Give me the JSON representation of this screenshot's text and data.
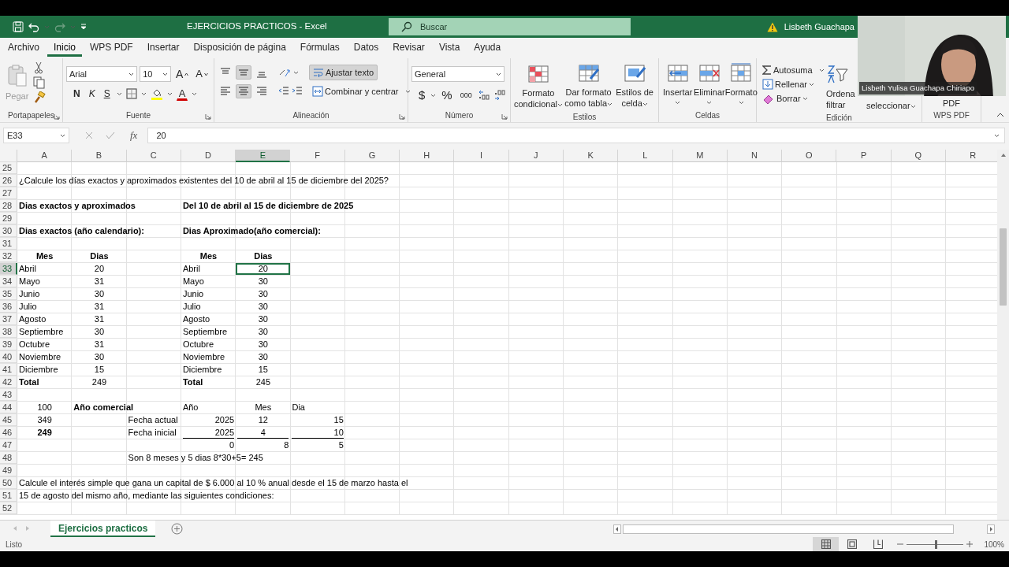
{
  "title_bar": {
    "title": "EJERCICIOS PRACTICOS  -  Excel",
    "search_placeholder": "Buscar",
    "user": "Lisbeth Guachapa"
  },
  "ribbon_tabs": [
    {
      "label": "Archivo",
      "selected": false
    },
    {
      "label": "Inicio",
      "selected": true
    },
    {
      "label": "WPS PDF",
      "selected": false
    },
    {
      "label": "Insertar",
      "selected": false
    },
    {
      "label": "Disposición de página",
      "selected": false
    },
    {
      "label": "Fórmulas",
      "selected": false
    },
    {
      "label": "Datos",
      "selected": false
    },
    {
      "label": "Revisar",
      "selected": false
    },
    {
      "label": "Vista",
      "selected": false
    },
    {
      "label": "Ayuda",
      "selected": false
    }
  ],
  "ribbon": {
    "clipboard": {
      "paste": "Pegar",
      "label": "Portapapeles"
    },
    "font": {
      "name": "Arial",
      "size": "10",
      "grow": "A",
      "shrink": "A",
      "bold": "N",
      "italic": "K",
      "underline": "S",
      "font_color_button": "A",
      "label": "Fuente"
    },
    "alignment": {
      "middle_on": true,
      "center_on": true,
      "wrap": "Ajustar texto",
      "wrap_on": true,
      "merge": "Combinar y centrar",
      "label": "Alineación"
    },
    "number": {
      "format": "General",
      "currency": "$",
      "percent": "%",
      "thousands": "000",
      "label": "Número"
    },
    "styles": {
      "conditional": "Formato\ncondicional",
      "table": "Dar formato\ncomo tabla",
      "cell": "Estilos de\ncelda",
      "label": "Estilos"
    },
    "cells": {
      "insert": "Insertar",
      "delete": "Eliminar",
      "format": "Formato",
      "label": "Celdas"
    },
    "editing": {
      "autosum": "Autosuma",
      "fill": "Rellenar",
      "clear": "Borrar",
      "sort": "Ordena\nfiltrar",
      "find": "seleccionar",
      "label": "Edición"
    },
    "wps": {
      "button": "PDF",
      "label": "WPS PDF"
    }
  },
  "formula_bar": {
    "name_box": "E33",
    "fx": "fx",
    "value": "20"
  },
  "sheet": {
    "columns": [
      {
        "label": "A",
        "selected": false
      },
      {
        "label": "B",
        "selected": false
      },
      {
        "label": "C",
        "selected": false
      },
      {
        "label": "D",
        "selected": false
      },
      {
        "label": "E",
        "selected": true
      },
      {
        "label": "F",
        "selected": false
      },
      {
        "label": "G",
        "selected": false
      },
      {
        "label": "H",
        "selected": false
      },
      {
        "label": "I",
        "selected": false
      },
      {
        "label": "J",
        "selected": false
      },
      {
        "label": "K",
        "selected": false
      },
      {
        "label": "L",
        "selected": false
      },
      {
        "label": "M",
        "selected": false
      },
      {
        "label": "N",
        "selected": false
      },
      {
        "label": "O",
        "selected": false
      },
      {
        "label": "P",
        "selected": false
      },
      {
        "label": "Q",
        "selected": false
      },
      {
        "label": "R",
        "selected": false
      }
    ],
    "rows": [
      {
        "label": "25",
        "selected": false,
        "cells": []
      },
      {
        "label": "26",
        "selected": false,
        "cells": [
          {
            "text": "¿Calcule los días exactos y aproximados existentes del  10 de abril al 15 de diciembre del 2025?",
            "kind": "text",
            "bold": false,
            "underlined": false,
            "selected": false
          }
        ]
      },
      {
        "label": "27",
        "selected": false,
        "cells": []
      },
      {
        "label": "28",
        "selected": false,
        "cells": [
          {
            "text": "Dias exactos y aproximados",
            "kind": "text",
            "bold": true,
            "underlined": false,
            "selected": false
          },
          "",
          "",
          {
            "text": "Del 10 de abril al 15 de diciembre de 2025",
            "kind": "text",
            "bold": true,
            "underlined": false,
            "selected": false
          }
        ]
      },
      {
        "label": "29",
        "selected": false,
        "cells": []
      },
      {
        "label": "30",
        "selected": false,
        "cells": [
          {
            "text": "Dias exactos (año calendario):",
            "kind": "text",
            "bold": true,
            "underlined": false,
            "selected": false
          },
          "",
          "",
          {
            "text": "Dias Aproximado(año comercial):",
            "kind": "text",
            "bold": true,
            "underlined": false,
            "selected": false
          }
        ]
      },
      {
        "label": "31",
        "selected": false,
        "cells": []
      },
      {
        "label": "32",
        "selected": false,
        "cells": [
          {
            "text": "Mes",
            "kind": "centered",
            "bold": true,
            "underlined": false,
            "selected": false
          },
          {
            "text": "Dias",
            "kind": "centered",
            "bold": true,
            "underlined": false,
            "selected": false
          },
          "",
          {
            "text": "Mes",
            "kind": "centered",
            "bold": true,
            "underlined": false,
            "selected": false
          },
          {
            "text": "Dias",
            "kind": "centered",
            "bold": true,
            "underlined": false,
            "selected": false
          }
        ]
      },
      {
        "label": "33",
        "selected": true,
        "cells": [
          {
            "text": "Abril",
            "kind": "text",
            "bold": false,
            "underlined": false,
            "selected": false
          },
          {
            "text": "20",
            "kind": "centered",
            "bold": false,
            "underlined": false,
            "selected": false
          },
          "",
          {
            "text": "Abril",
            "kind": "text",
            "bold": false,
            "underlined": false,
            "selected": false
          },
          {
            "text": "20",
            "kind": "centered",
            "bold": false,
            "underlined": false,
            "selected": true
          }
        ]
      },
      {
        "label": "34",
        "selected": false,
        "cells": [
          {
            "text": "Mayo",
            "kind": "text",
            "bold": false,
            "underlined": false,
            "selected": false
          },
          {
            "text": "31",
            "kind": "centered",
            "bold": false,
            "underlined": false,
            "selected": false
          },
          "",
          {
            "text": "Mayo",
            "kind": "text",
            "bold": false,
            "underlined": false,
            "selected": false
          },
          {
            "text": "30",
            "kind": "centered",
            "bold": false,
            "underlined": false,
            "selected": false
          }
        ]
      },
      {
        "label": "35",
        "selected": false,
        "cells": [
          {
            "text": "Junio",
            "kind": "text",
            "bold": false,
            "underlined": false,
            "selected": false
          },
          {
            "text": "30",
            "kind": "centered",
            "bold": false,
            "underlined": false,
            "selected": false
          },
          "",
          {
            "text": "Junio",
            "kind": "text",
            "bold": false,
            "underlined": false,
            "selected": false
          },
          {
            "text": "30",
            "kind": "centered",
            "bold": false,
            "underlined": false,
            "selected": false
          }
        ]
      },
      {
        "label": "36",
        "selected": false,
        "cells": [
          {
            "text": "Julio",
            "kind": "text",
            "bold": false,
            "underlined": false,
            "selected": false
          },
          {
            "text": "31",
            "kind": "centered",
            "bold": false,
            "underlined": false,
            "selected": false
          },
          "",
          {
            "text": "Julio",
            "kind": "text",
            "bold": false,
            "underlined": false,
            "selected": false
          },
          {
            "text": "30",
            "kind": "centered",
            "bold": false,
            "underlined": false,
            "selected": false
          }
        ]
      },
      {
        "label": "37",
        "selected": false,
        "cells": [
          {
            "text": "Agosto",
            "kind": "text",
            "bold": false,
            "underlined": false,
            "selected": false
          },
          {
            "text": "31",
            "kind": "centered",
            "bold": false,
            "underlined": false,
            "selected": false
          },
          "",
          {
            "text": "Agosto",
            "kind": "text",
            "bold": false,
            "underlined": false,
            "selected": false
          },
          {
            "text": "30",
            "kind": "centered",
            "bold": false,
            "underlined": false,
            "selected": false
          }
        ]
      },
      {
        "label": "38",
        "selected": false,
        "cells": [
          {
            "text": "Septiembre",
            "kind": "text",
            "bold": false,
            "underlined": false,
            "selected": false
          },
          {
            "text": "30",
            "kind": "centered",
            "bold": false,
            "underlined": false,
            "selected": false
          },
          "",
          {
            "text": "Septiembre",
            "kind": "text",
            "bold": false,
            "underlined": false,
            "selected": false
          },
          {
            "text": "30",
            "kind": "centered",
            "bold": false,
            "underlined": false,
            "selected": false
          }
        ]
      },
      {
        "label": "39",
        "selected": false,
        "cells": [
          {
            "text": "Octubre",
            "kind": "text",
            "bold": false,
            "underlined": false,
            "selected": false
          },
          {
            "text": "31",
            "kind": "centered",
            "bold": false,
            "underlined": false,
            "selected": false
          },
          "",
          {
            "text": "Octubre",
            "kind": "text",
            "bold": false,
            "underlined": false,
            "selected": false
          },
          {
            "text": "30",
            "kind": "centered",
            "bold": false,
            "underlined": false,
            "selected": false
          }
        ]
      },
      {
        "label": "40",
        "selected": false,
        "cells": [
          {
            "text": "Noviembre",
            "kind": "text",
            "bold": false,
            "underlined": false,
            "selected": false
          },
          {
            "text": "30",
            "kind": "centered",
            "bold": false,
            "underlined": false,
            "selected": false
          },
          "",
          {
            "text": "Noviembre",
            "kind": "text",
            "bold": false,
            "underlined": false,
            "selected": false
          },
          {
            "text": "30",
            "kind": "centered",
            "bold": false,
            "underlined": false,
            "selected": false
          }
        ]
      },
      {
        "label": "41",
        "selected": false,
        "cells": [
          {
            "text": "Diciembre",
            "kind": "text",
            "bold": false,
            "underlined": false,
            "selected": false
          },
          {
            "text": "15",
            "kind": "centered",
            "bold": false,
            "underlined": false,
            "selected": false
          },
          "",
          {
            "text": "Diciembre",
            "kind": "text",
            "bold": false,
            "underlined": false,
            "selected": false
          },
          {
            "text": "15",
            "kind": "centered",
            "bold": false,
            "underlined": false,
            "selected": false
          }
        ]
      },
      {
        "label": "42",
        "selected": false,
        "cells": [
          {
            "text": "Total",
            "kind": "text",
            "bold": true,
            "underlined": false,
            "selected": false
          },
          {
            "text": "249",
            "kind": "centered",
            "bold": false,
            "underlined": false,
            "selected": false
          },
          "",
          {
            "text": "Total",
            "kind": "text",
            "bold": true,
            "underlined": false,
            "selected": false
          },
          {
            "text": "245",
            "kind": "centered",
            "bold": false,
            "underlined": false,
            "selected": false
          }
        ]
      },
      {
        "label": "43",
        "selected": false,
        "cells": []
      },
      {
        "label": "44",
        "selected": false,
        "cells": [
          {
            "text": "100",
            "kind": "centered",
            "bold": false,
            "underlined": false,
            "selected": false
          },
          {
            "text": "Año comercial",
            "kind": "text",
            "bold": true,
            "underlined": false,
            "selected": false
          },
          "",
          {
            "text": "Año",
            "kind": "text",
            "bold": false,
            "underlined": false,
            "selected": false
          },
          {
            "text": "Mes",
            "kind": "centered",
            "bold": false,
            "underlined": false,
            "selected": false
          },
          {
            "text": "Dia",
            "kind": "text",
            "bold": false,
            "underlined": false,
            "selected": false
          }
        ]
      },
      {
        "label": "45",
        "selected": false,
        "cells": [
          {
            "text": "349",
            "kind": "centered",
            "bold": false,
            "underlined": false,
            "selected": false
          },
          "",
          {
            "text": "Fecha actual",
            "kind": "text",
            "bold": false,
            "underlined": false,
            "selected": false
          },
          {
            "text": "2025",
            "kind": "number",
            "bold": false,
            "underlined": false,
            "selected": false
          },
          {
            "text": "12",
            "kind": "centered",
            "bold": false,
            "underlined": false,
            "selected": false
          },
          {
            "text": "15",
            "kind": "number",
            "bold": false,
            "underlined": false,
            "selected": false
          }
        ]
      },
      {
        "label": "46",
        "selected": false,
        "cells": [
          {
            "text": "249",
            "kind": "centered",
            "bold": true,
            "underlined": false,
            "selected": false
          },
          "",
          {
            "text": "Fecha inicial",
            "kind": "text",
            "bold": false,
            "underlined": false,
            "selected": false
          },
          {
            "text": "2025",
            "kind": "number",
            "bold": false,
            "underlined": true,
            "selected": false
          },
          {
            "text": "4",
            "kind": "centered",
            "bold": false,
            "underlined": true,
            "selected": false
          },
          {
            "text": "10",
            "kind": "number",
            "bold": false,
            "underlined": true,
            "selected": false
          }
        ]
      },
      {
        "label": "47",
        "selected": false,
        "cells": [
          "",
          "",
          "",
          {
            "text": "0",
            "kind": "number",
            "bold": false,
            "underlined": false,
            "selected": false
          },
          {
            "text": "8",
            "kind": "number",
            "bold": false,
            "underlined": false,
            "selected": false
          },
          {
            "text": "5",
            "kind": "number",
            "bold": false,
            "underlined": false,
            "selected": false
          }
        ]
      },
      {
        "label": "48",
        "selected": false,
        "cells": [
          "",
          "",
          {
            "text": "Son 8 meses y 5 dias 8*30+5= 245",
            "kind": "text",
            "bold": false,
            "underlined": false,
            "selected": false
          }
        ]
      },
      {
        "label": "49",
        "selected": false,
        "cells": []
      },
      {
        "label": "50",
        "selected": false,
        "cells": [
          {
            "text": "Calcule el interés simple que gana un capital de $ 6.000 al 10 % anual desde el 15 de marzo hasta el",
            "kind": "text",
            "bold": false,
            "underlined": false,
            "selected": false
          }
        ]
      },
      {
        "label": "51",
        "selected": false,
        "cells": [
          {
            "text": "15 de agosto del mismo año, mediante las siguientes condiciones:",
            "kind": "text",
            "bold": false,
            "underlined": false,
            "selected": false
          }
        ]
      },
      {
        "label": "52",
        "selected": false,
        "cells": []
      }
    ]
  },
  "sheet_tabs": [
    {
      "label": "Ejercicios practicos",
      "selected": true
    }
  ],
  "status_bar": {
    "text": "Listo",
    "zoom": "100%",
    "zoom_slider": {
      "level": 0.5
    }
  },
  "webcam": {
    "kind": "picture",
    "caption": "Lisbeth Yulisa Guachapa Chiriapo"
  }
}
